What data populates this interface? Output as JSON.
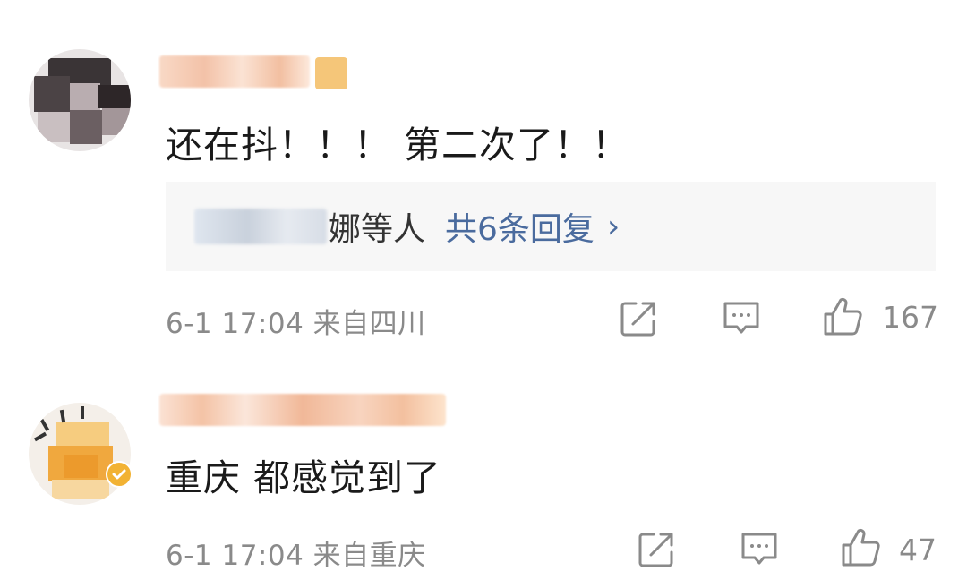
{
  "comments": [
    {
      "text": "还在抖！！！ 第二次了！！",
      "reply_preview": {
        "users_suffix": "娜等人",
        "count_label": "共6条回复",
        "chevron": "›"
      },
      "meta": "6-1 17:04  来自四川",
      "icons": [
        "share-icon",
        "comment-icon",
        "like-icon"
      ],
      "like_count": "167"
    },
    {
      "text": "重庆 都感觉到了",
      "meta": "6-1 17:04  来自重庆",
      "icons": [
        "share-icon",
        "comment-icon",
        "like-icon"
      ],
      "like_count": "47"
    }
  ],
  "colors": {
    "link": "#4a6b9e",
    "text": "#1a1a1a",
    "meta": "#8a8a8a",
    "reply_bg": "#f7f7f7"
  }
}
